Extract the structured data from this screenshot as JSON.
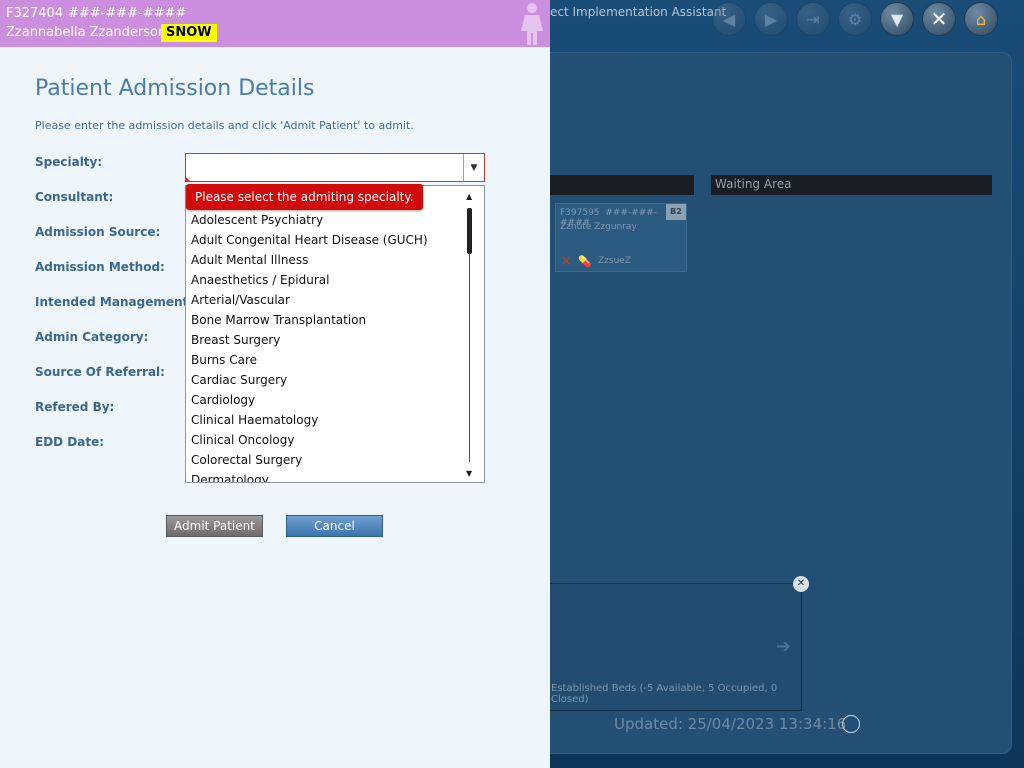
{
  "background": {
    "window_title": "ect Implementation Assistant",
    "ward_columns": [
      "",
      "Waiting Area"
    ],
    "bed_card": {
      "id": "F397595",
      "nhs": "###-###-####",
      "name": "Zznute Zzgunray",
      "bed": "B2",
      "nickname": "ZzsueZ"
    },
    "beds_summary": "Established Beds (-5 Available, 5 Occupied, 0 Closed)",
    "updated": "Updated: 25/04/2023 13:34:16"
  },
  "patient": {
    "id": "F327404",
    "nhs": "###-###-####",
    "name": "Zzannabella Zzanderson",
    "flag": "SNOW"
  },
  "form": {
    "title": "Patient Admission Details",
    "subtitle": "Please enter the admission details and click 'Admit Patient' to admit.",
    "labels": [
      "Specialty:",
      "Consultant:",
      "Admission Source:",
      "Admission Method:",
      "Intended Management:",
      "Admin Category:",
      "Source Of Referral:",
      "Refered By:",
      "EDD Date:"
    ],
    "specialty_value": "",
    "validation_message": "Please select the admiting specialty.",
    "specialty_options": [
      "Adolescent Psychiatry",
      "Adult Congenital Heart Disease (GUCH)",
      "Adult Mental Illness",
      "Anaesthetics / Epidural",
      "Arterial/Vascular",
      "Bone Marrow Transplantation",
      "Breast Surgery",
      "Burns Care",
      "Cardiac Surgery",
      "Cardiology",
      "Clinical Haematology",
      "Clinical Oncology",
      "Colorectal Surgery",
      "Dermatology"
    ],
    "admit_label": "Admit Patient",
    "cancel_label": "Cancel"
  },
  "colors": {
    "banner": "#cc8fe0",
    "flag": "#ffff00",
    "accent": "#4a7cab",
    "error": "#d10a0a"
  }
}
